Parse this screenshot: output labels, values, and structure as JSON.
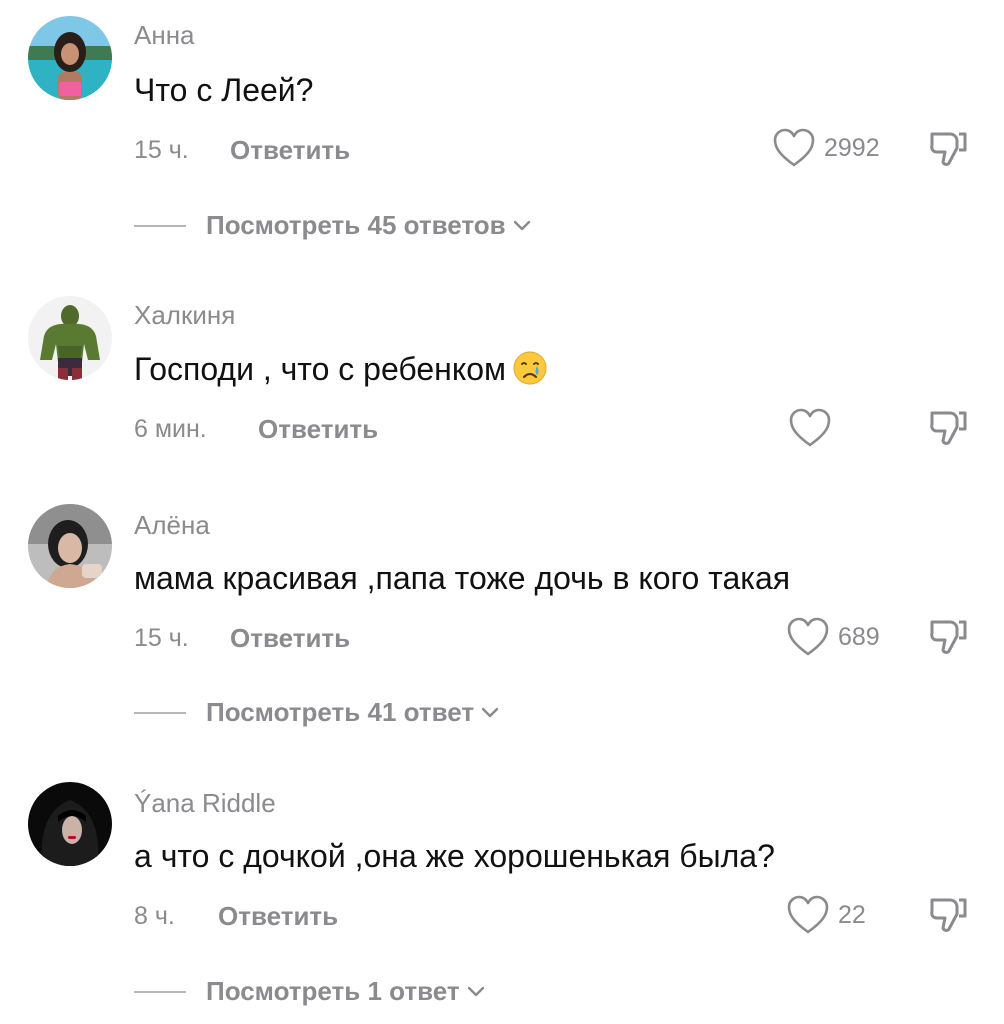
{
  "comments": [
    {
      "username": "Анна",
      "text": "Что с Леей?",
      "time": "15 ч.",
      "reply_label": "Ответить",
      "likes": "2992",
      "view_replies": "Посмотреть 45 ответов"
    },
    {
      "username": "Халкиня",
      "text": "Господи , что с ребенком",
      "emoji": "crying-face-emoji",
      "time": "6 мин.",
      "reply_label": "Ответить",
      "likes": ""
    },
    {
      "username": "Алёна",
      "text": "мама красивая ,папа тоже дочь в кого такая",
      "time": "15 ч.",
      "reply_label": "Ответить",
      "likes": "689",
      "view_replies": "Посмотреть 41 ответ"
    },
    {
      "username": "Ýana Riddle",
      "text": "а что с дочкой ,она же хорошенькая была?",
      "time": "8 ч.",
      "reply_label": "Ответить",
      "likes": "22",
      "view_replies": "Посмотреть 1 ответ"
    }
  ],
  "icons": {
    "like": "heart-outline-icon",
    "dislike": "thumbs-down-outline-icon",
    "expand": "chevron-down-icon"
  },
  "colors": {
    "muted_text": "#8a8a8f",
    "primary_text": "#111111",
    "background": "#ffffff"
  }
}
